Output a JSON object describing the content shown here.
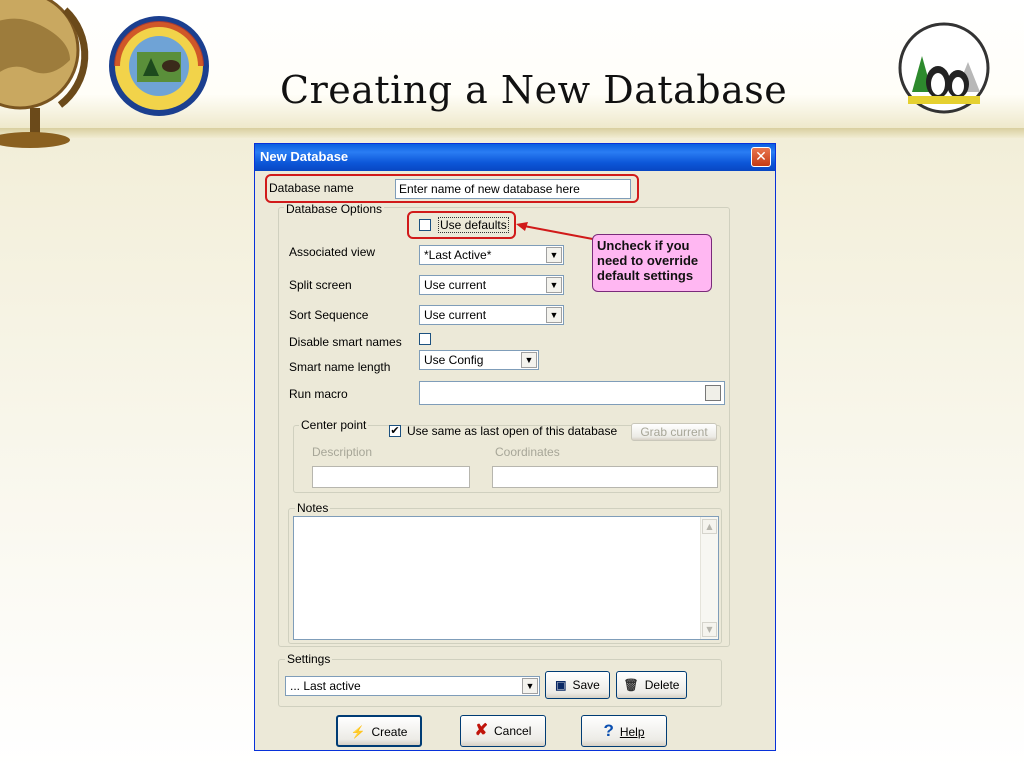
{
  "slide": {
    "title": "Creating a New Database"
  },
  "dialog": {
    "title": "New Database",
    "close_glyph": "✕",
    "database_name_label": "Database name",
    "database_name_value": "Enter name of new database here",
    "options_group_title": "Database Options",
    "use_defaults_label": "Use defaults",
    "use_defaults_checked": false,
    "associated_view_label": "Associated view",
    "associated_view_value": "*Last Active*",
    "split_screen_label": "Split screen",
    "split_screen_value": "Use current",
    "sort_sequence_label": "Sort Sequence",
    "sort_sequence_value": "Use current",
    "disable_smart_names_label": "Disable smart names",
    "disable_smart_names_checked": false,
    "smart_name_length_label": "Smart name length",
    "smart_name_length_value": "Use Config",
    "run_macro_label": "Run macro",
    "run_macro_value": "",
    "center_point": {
      "group_title": "Center point",
      "use_same_label": "Use same as last open of this database",
      "use_same_checked": true,
      "grab_current_label": "Grab current",
      "description_label": "Description",
      "coordinates_label": "Coordinates"
    },
    "notes": {
      "group_title": "Notes",
      "value": ""
    },
    "settings": {
      "group_title": "Settings",
      "value": "... Last active",
      "save_label": "Save",
      "delete_label": "Delete"
    },
    "buttons": {
      "create": "Create",
      "cancel": "Cancel",
      "help": "Help"
    }
  },
  "callout": {
    "text": "Uncheck if you need to override default settings"
  },
  "colors": {
    "titlebar": "#0a5fe0",
    "dialog_bg": "#ece9d8",
    "highlight": "#d11a1a",
    "callout_bg": "#ffb7f2"
  }
}
